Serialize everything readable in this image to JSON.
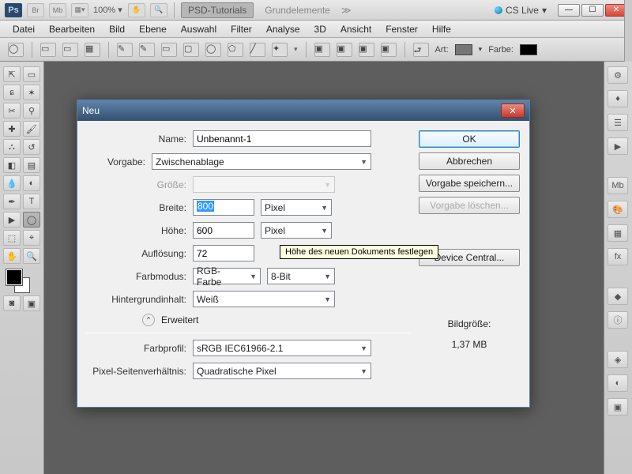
{
  "appbar": {
    "br": "Br",
    "mb": "Mb",
    "zoom_percent": "100%",
    "tab_active": "PSD-Tutorials",
    "tab2": "Grundelemente",
    "cslive": "CS Live"
  },
  "menu": {
    "items": [
      "Datei",
      "Bearbeiten",
      "Bild",
      "Ebene",
      "Auswahl",
      "Filter",
      "Analyse",
      "3D",
      "Ansicht",
      "Fenster",
      "Hilfe"
    ]
  },
  "optbar": {
    "art": "Art:",
    "farbe": "Farbe:"
  },
  "dialog": {
    "title": "Neu",
    "labels": {
      "name": "Name:",
      "preset": "Vorgabe:",
      "size": "Größe:",
      "width": "Breite:",
      "height": "Höhe:",
      "resolution": "Auflösung:",
      "colormode": "Farbmodus:",
      "bgcontent": "Hintergrundinhalt:",
      "advanced": "Erweitert",
      "colorprofile": "Farbprofil:",
      "pixelratio": "Pixel-Seitenverhältnis:"
    },
    "values": {
      "name": "Unbenannt-1",
      "preset": "Zwischenablage",
      "size": "",
      "width": "800",
      "height": "600",
      "resolution": "72",
      "width_unit": "Pixel",
      "height_unit": "Pixel",
      "colormode": "RGB-Farbe",
      "bitdepth": "8-Bit",
      "bgcontent": "Weiß",
      "colorprofile": "sRGB IEC61966-2.1",
      "pixelratio": "Quadratische Pixel"
    },
    "buttons": {
      "ok": "OK",
      "cancel": "Abbrechen",
      "save_preset": "Vorgabe speichern...",
      "delete_preset": "Vorgabe löschen...",
      "device_central": "Device Central..."
    },
    "imagesize_label": "Bildgröße:",
    "imagesize_value": "1,37 MB",
    "tooltip": "Höhe des neuen Dokuments festlegen"
  }
}
